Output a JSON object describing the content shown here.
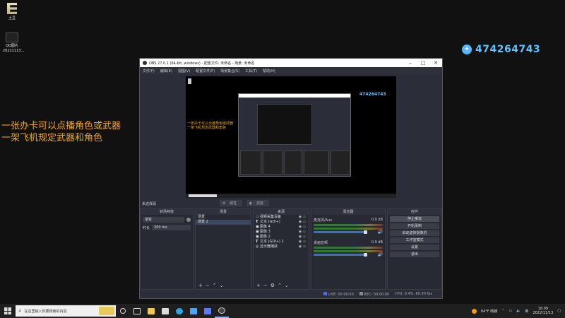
{
  "desktop": {
    "icon1_label": "土豆",
    "icon2_label": "QQ图片",
    "icon2_sub": "20221113..."
  },
  "qq_number": "474264743",
  "overlay_lines": [
    "一张办卡可以点播角色或武器",
    "一架飞机规定武器和角色"
  ],
  "obs": {
    "title": "OBS 27.0.1 (64-bit, windows) - 配置文件: 未命名 - 场景: 未命名",
    "menu": [
      "文件(F)",
      "编辑(E)",
      "视图(V)",
      "配置文件(P)",
      "场景集合(S)",
      "工具(T)",
      "帮助(H)"
    ],
    "no_source": "未选择源",
    "prop_btn": "属性",
    "filter_btn": "滤镜",
    "docks": {
      "transitions": "转场特效",
      "scenes": "场景",
      "sources": "来源",
      "mixer": "混音器",
      "controls": "控件"
    },
    "transition": {
      "type": "渐变",
      "duration_label": "时长",
      "duration_value": "300 ms"
    },
    "scenes": [
      "场景",
      "场景 2"
    ],
    "sources": [
      {
        "icon": "▭",
        "label": "视频采集设备"
      },
      {
        "icon": "T",
        "label": "文本 (GDI+)"
      },
      {
        "icon": "▣",
        "label": "图像 4"
      },
      {
        "icon": "▣",
        "label": "图像 3"
      },
      {
        "icon": "▣",
        "label": "图像 2"
      },
      {
        "icon": "T",
        "label": "文本 (GDI+) 2"
      },
      {
        "icon": "◎",
        "label": "显示器捕获"
      }
    ],
    "mixer": [
      {
        "name": "麦克风/Aux",
        "db": "0.0 dB"
      },
      {
        "name": "桌面音频",
        "db": "0.0 dB"
      }
    ],
    "controls": [
      "停止推流",
      "开始录制",
      "启动虚拟摄像机",
      "工作室模式",
      "设置",
      "退出"
    ],
    "status": {
      "live": "LIVE: 00:00:00",
      "rec": "REC: 00:00:00",
      "cpu": "CPU: 0.4%, 60.00 fps"
    }
  },
  "taskbar": {
    "search_placeholder": "在这里输入你要搜索的内容",
    "weather": "84°F 晴朗",
    "lang": "英",
    "time": "16:09",
    "date": "2022/11/13"
  }
}
